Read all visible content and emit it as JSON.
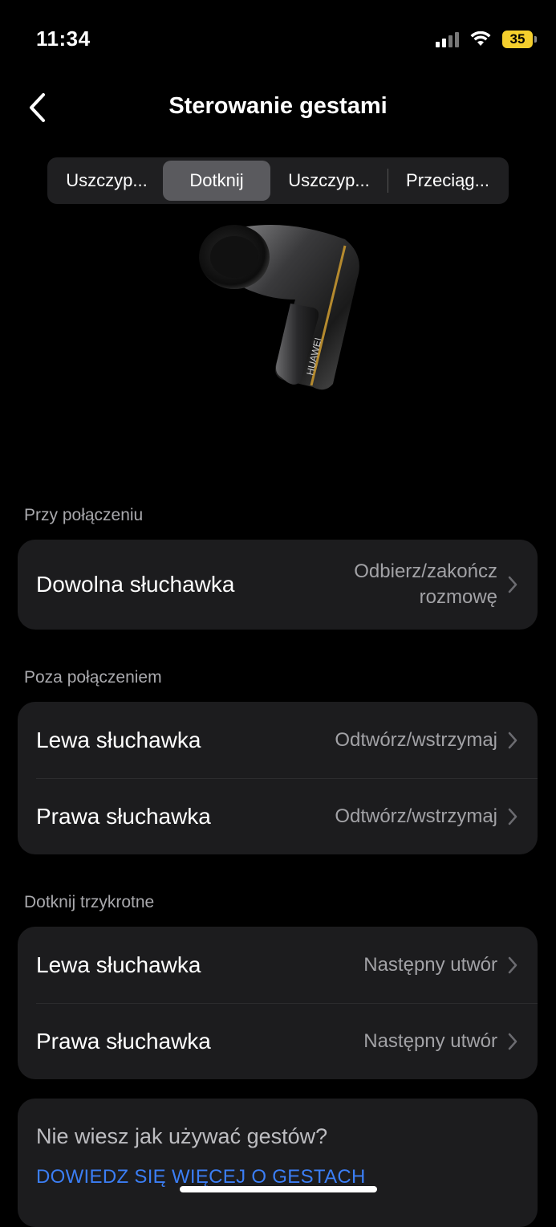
{
  "status_bar": {
    "time": "11:34",
    "battery": "35",
    "battery_color": "#f5cf2d"
  },
  "header": {
    "title": "Sterowanie gestami",
    "back_icon": "chevron-left-icon"
  },
  "tabs": [
    {
      "label": "Uszczyp..."
    },
    {
      "label": "Dotknij",
      "active": true
    },
    {
      "label": "Uszczyp..."
    },
    {
      "label": "Przeciąg..."
    }
  ],
  "sections": {
    "call": {
      "title": "Przy połączeniu",
      "rows": [
        {
          "label": "Dowolna słuchawka",
          "value": "Odbierz/zakończ rozmowę"
        }
      ]
    },
    "no_call": {
      "title": "Poza połączeniem",
      "rows": [
        {
          "label": "Lewa słuchawka",
          "value": "Odtwórz/wstrzymaj"
        },
        {
          "label": "Prawa słuchawka",
          "value": "Odtwórz/wstrzymaj"
        }
      ]
    },
    "triple_tap": {
      "title": "Dotknij trzykrotne",
      "rows": [
        {
          "label": "Lewa słuchawka",
          "value": "Następny utwór"
        },
        {
          "label": "Prawa słuchawka",
          "value": "Następny utwór"
        }
      ]
    }
  },
  "help": {
    "question": "Nie wiesz jak używać gestów?",
    "link": "DOWIEDZ SIĘ WIĘCEJ O GESTACH",
    "link_color": "#3b7ef5"
  },
  "earbud_brand": "HUAWEI"
}
